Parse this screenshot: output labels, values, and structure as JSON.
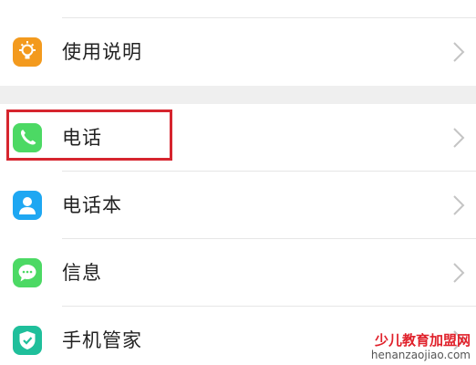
{
  "settings_list": {
    "items": [
      {
        "label": "使用说明",
        "icon": "lightbulb-icon",
        "icon_color": "#f39a1e"
      },
      {
        "label": "电话",
        "icon": "phone-icon",
        "icon_color": "#4cd964"
      },
      {
        "label": "电话本",
        "icon": "contact-icon",
        "icon_color": "#1ea7f2"
      },
      {
        "label": "信息",
        "icon": "message-icon",
        "icon_color": "#4cd964"
      },
      {
        "label": "手机管家",
        "icon": "shield-icon",
        "icon_color": "#1fbf9b"
      }
    ]
  },
  "highlight": {
    "color": "#d6252e",
    "target": "电话"
  },
  "watermark": {
    "name": "少儿教育加盟网",
    "url": "henanzaojiao.com"
  }
}
